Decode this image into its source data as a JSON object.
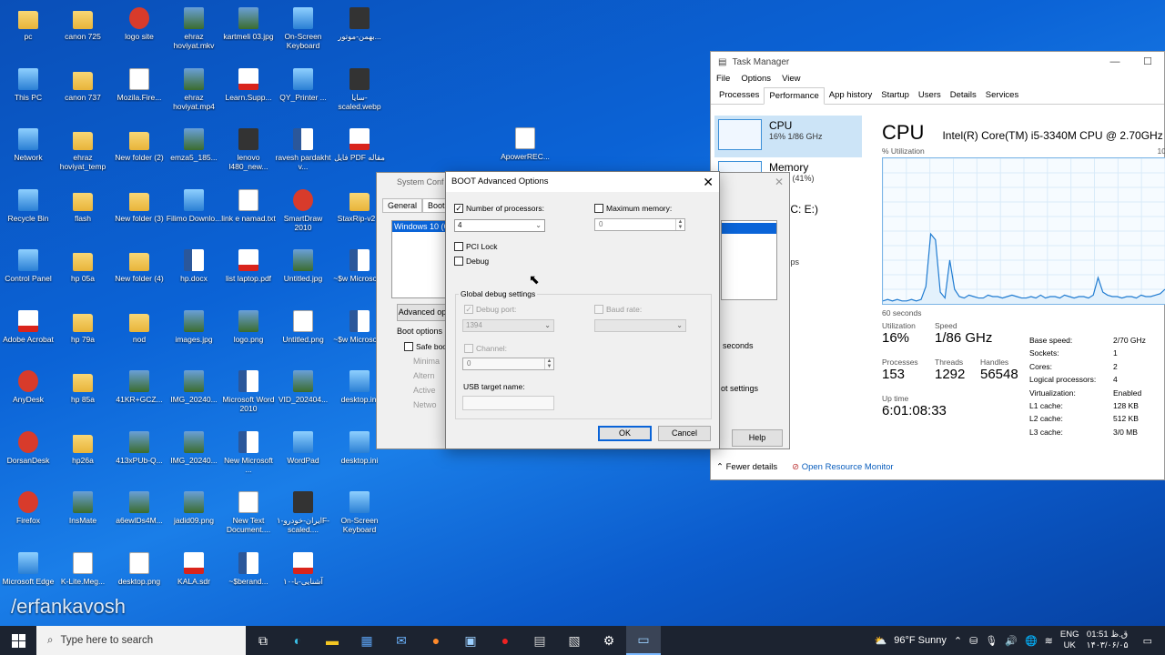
{
  "desktop_icons": [
    {
      "label": "pc",
      "type": "folder"
    },
    {
      "label": "canon 725",
      "type": "folder"
    },
    {
      "label": "logo site",
      "type": "app"
    },
    {
      "label": "ehraz hoviyat.mkv",
      "type": "img"
    },
    {
      "label": "kartmeli 03.jpg",
      "type": "img"
    },
    {
      "label": "On-Screen Keyboard",
      "type": "sys"
    },
    {
      "label": "بهمن-موتور...",
      "type": "dark"
    },
    {
      "label": "This PC",
      "type": "sys"
    },
    {
      "label": "canon 737",
      "type": "folder"
    },
    {
      "label": "Mozila.Fire...",
      "type": "doc"
    },
    {
      "label": "ehraz hoviyat.mp4",
      "type": "img"
    },
    {
      "label": "Learn.Supp...",
      "type": "pdf"
    },
    {
      "label": "QY_Printer ...",
      "type": "sys"
    },
    {
      "label": "سایا-scaled.webp",
      "type": "dark"
    },
    {
      "label": "Network",
      "type": "sys"
    },
    {
      "label": "ehraz hoviyat_temp",
      "type": "folder"
    },
    {
      "label": "New folder (2)",
      "type": "folder"
    },
    {
      "label": "emza5_185...",
      "type": "img"
    },
    {
      "label": "lenovo l480_new...",
      "type": "dark"
    },
    {
      "label": "ravesh pardakht v...",
      "type": "word"
    },
    {
      "label": "فایل PDF مقاله",
      "type": "pdf"
    },
    {
      "label": "Recycle Bin",
      "type": "sys"
    },
    {
      "label": "flash",
      "type": "folder"
    },
    {
      "label": "New folder (3)",
      "type": "folder"
    },
    {
      "label": "Filimo Downlo...",
      "type": "sys"
    },
    {
      "label": "link e namad.txt",
      "type": "doc"
    },
    {
      "label": "SmartDraw 2010",
      "type": "app"
    },
    {
      "label": "StaxRip-v2...",
      "type": "folder"
    },
    {
      "label": "Control Panel",
      "type": "sys"
    },
    {
      "label": "hp 05a",
      "type": "folder"
    },
    {
      "label": "New folder (4)",
      "type": "folder"
    },
    {
      "label": "hp.docx",
      "type": "word"
    },
    {
      "label": "list laptop.pdf",
      "type": "pdf"
    },
    {
      "label": "Untitled.jpg",
      "type": "img"
    },
    {
      "label": "~$w Microsof...",
      "type": "word"
    },
    {
      "label": "Adobe Acrobat",
      "type": "pdf"
    },
    {
      "label": "hp 79a",
      "type": "folder"
    },
    {
      "label": "nod",
      "type": "folder"
    },
    {
      "label": "images.jpg",
      "type": "img"
    },
    {
      "label": "logo.png",
      "type": "img"
    },
    {
      "label": "Untitled.png",
      "type": "doc"
    },
    {
      "label": "~$w Microsof...",
      "type": "word"
    },
    {
      "label": "AnyDesk",
      "type": "app"
    },
    {
      "label": "hp 85a",
      "type": "folder"
    },
    {
      "label": "41KR+GCZ...",
      "type": "img"
    },
    {
      "label": "IMG_20240...",
      "type": "img"
    },
    {
      "label": "Microsoft Word 2010",
      "type": "word"
    },
    {
      "label": "VID_202404...",
      "type": "img"
    },
    {
      "label": "desktop.ini",
      "type": "sys"
    },
    {
      "label": "DorsanDesk",
      "type": "app"
    },
    {
      "label": "hp26a",
      "type": "folder"
    },
    {
      "label": "413xPUb-Q...",
      "type": "img"
    },
    {
      "label": "IMG_20240...",
      "type": "img"
    },
    {
      "label": "New Microsoft ...",
      "type": "word"
    },
    {
      "label": "WordPad",
      "type": "sys"
    },
    {
      "label": "desktop.ini",
      "type": "sys"
    },
    {
      "label": "Firefox",
      "type": "app"
    },
    {
      "label": "InsMate",
      "type": "img"
    },
    {
      "label": "a6ewlDs4M...",
      "type": "img"
    },
    {
      "label": "jadid09.png",
      "type": "img"
    },
    {
      "label": "New Text Document....",
      "type": "doc"
    },
    {
      "label": "ایران-خودرو-۱F-scaled....",
      "type": "dark"
    },
    {
      "label": "On-Screen Keyboard",
      "type": "sys"
    },
    {
      "label": "Microsoft Edge",
      "type": "sys"
    },
    {
      "label": "K-Lite.Meg...",
      "type": "doc"
    },
    {
      "label": "desktop.png",
      "type": "doc"
    },
    {
      "label": "KALA.sdr",
      "type": "pdf"
    },
    {
      "label": "~$berand...",
      "type": "word"
    },
    {
      "label": "آشنایی-با-۱۰",
      "type": "pdf"
    },
    {
      "label": "",
      "type": "none"
    }
  ],
  "extra_icon": {
    "label": "ApowerREC...",
    "type": "doc"
  },
  "watermark": "/erfankavosh",
  "task_manager": {
    "title": "Task Manager",
    "menu": [
      "File",
      "Options",
      "View"
    ],
    "tabs": [
      "Processes",
      "Performance",
      "App history",
      "Startup",
      "Users",
      "Details",
      "Services"
    ],
    "active_tab": "Performance",
    "side": [
      {
        "name": "CPU",
        "detail": "16% 1/86 GHz"
      },
      {
        "name": "Memory",
        "detail": "/9 GB (41%)"
      },
      {
        "name": "k 0 (C: E:)",
        "detail": ""
      },
      {
        "name": "Fi",
        "detail": ": 0 Kbps"
      }
    ],
    "cpu_heading": "CPU",
    "cpu_model": "Intel(R) Core(TM) i5-3340M CPU @ 2.70GHz",
    "util_label": "% Utilization",
    "util_max": "10",
    "graph_span": "60 seconds",
    "graph_points": [
      2,
      3,
      2,
      3,
      2,
      2,
      3,
      2,
      3,
      12,
      48,
      44,
      8,
      4,
      30,
      10,
      5,
      4,
      6,
      5,
      4,
      4,
      6,
      5,
      5,
      4,
      5,
      6,
      5,
      4,
      4,
      5,
      4,
      6,
      4,
      5,
      5,
      4,
      6,
      5,
      4,
      5,
      5,
      4,
      6,
      18,
      8,
      6,
      5,
      5,
      4,
      5,
      5,
      4,
      6,
      5,
      5,
      6,
      7,
      10
    ],
    "stats": {
      "utilization_label": "Utilization",
      "utilization": "16%",
      "speed_label": "Speed",
      "speed": "1/86 GHz",
      "processes_label": "Processes",
      "processes": "153",
      "threads_label": "Threads",
      "threads": "1292",
      "handles_label": "Handles",
      "handles": "56548",
      "uptime_label": "Up time",
      "uptime": "6:01:08:33"
    },
    "details": [
      {
        "k": "Base speed:",
        "v": "2/70 GHz"
      },
      {
        "k": "Sockets:",
        "v": "1"
      },
      {
        "k": "Cores:",
        "v": "2"
      },
      {
        "k": "Logical processors:",
        "v": "4"
      },
      {
        "k": "Virtualization:",
        "v": "Enabled"
      },
      {
        "k": "L1 cache:",
        "v": "128 KB"
      },
      {
        "k": "L2 cache:",
        "v": "512 KB"
      },
      {
        "k": "L3 cache:",
        "v": "3/0 MB"
      }
    ],
    "fewer_details": "Fewer details",
    "open_monitor": "Open Resource Monitor"
  },
  "sysconfig": {
    "title": "System Conf",
    "tabs": [
      "General",
      "Boot"
    ],
    "list_item": "Windows 10 (C",
    "advanced_label": "Advanced op",
    "boot_options_label": "Boot options",
    "safe_boot": "Safe boot",
    "radios": [
      "Minima",
      "Altern",
      "Active",
      "Netwo"
    ],
    "seconds": "seconds",
    "boot_settings": "ot settings",
    "help": "Help"
  },
  "boot_dialog": {
    "title": "BOOT Advanced Options",
    "num_processors_label": "Number of processors:",
    "num_processors_value": "4",
    "max_memory_label": "Maximum memory:",
    "max_memory_value": "0",
    "pci_lock": "PCI Lock",
    "debug": "Debug",
    "global_debug": "Global debug settings",
    "debug_port_label": "Debug port:",
    "debug_port_value": "1394",
    "baud_rate_label": "Baud rate:",
    "channel_label": "Channel:",
    "channel_value": "0",
    "usb_target_label": "USB target name:",
    "ok": "OK",
    "cancel": "Cancel"
  },
  "taskbar": {
    "search_placeholder": "Type here to search",
    "weather": "96°F  Sunny",
    "lang_top": "ENG",
    "lang_bottom": "UK",
    "time": "01:51 ق.ظ",
    "date": "۱۴۰۳/۰۶/۰۵"
  }
}
